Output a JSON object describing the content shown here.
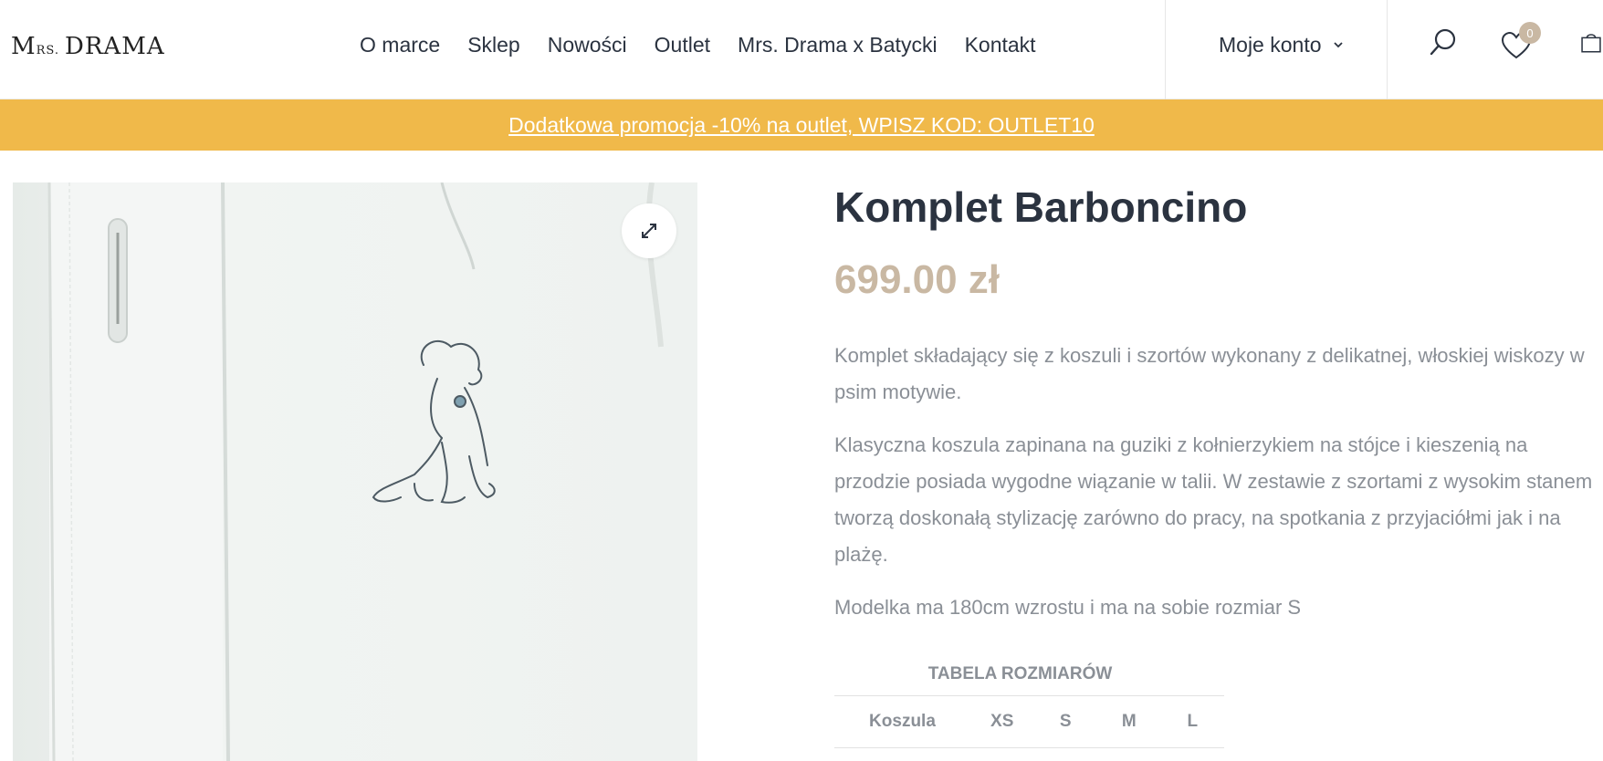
{
  "header": {
    "logo": {
      "m": "M",
      "rs": "RS.",
      "drama": "DRAMA"
    },
    "nav": [
      "O marce",
      "Sklep",
      "Nowości",
      "Outlet",
      "Mrs. Drama x Batycki",
      "Kontakt"
    ],
    "account_label": "Moje konto",
    "wishlist_count": "0",
    "icons": [
      "search-icon",
      "heart-icon",
      "cart-icon",
      "chevron-down-icon"
    ]
  },
  "promo": {
    "text": "Dodatkowa promocja -10% na outlet, WPISZ KOD: OUTLET10",
    "color": "#f0b94a"
  },
  "product": {
    "title": "Komplet Barboncino",
    "price": "699.00 zł",
    "description": [
      "Komplet składający się z koszuli i szortów wykonany z delikatnej, włoskiej wiskozy w psim motywie.",
      "Klasyczna koszula zapinana na guziki z kołnierzykiem na stójce i kieszenią na przodzie posiada wygodne wiązanie w talii. W zestawie z szortami z wysokim stanem tworzą doskonałą stylizację zarówno do pracy, na spotkania z przyjaciółmi jak i na plażę.",
      "Modelka ma 180cm wzrostu i ma na sobie rozmiar S"
    ],
    "size_table": {
      "caption": "TABELA ROZMIARÓW",
      "header": [
        "Koszula",
        "XS",
        "S",
        "M",
        "L"
      ]
    }
  },
  "colors": {
    "text": "#2b3340",
    "muted": "#8a8f96",
    "price": "#c9b8a3",
    "accent": "#f0b94a"
  }
}
